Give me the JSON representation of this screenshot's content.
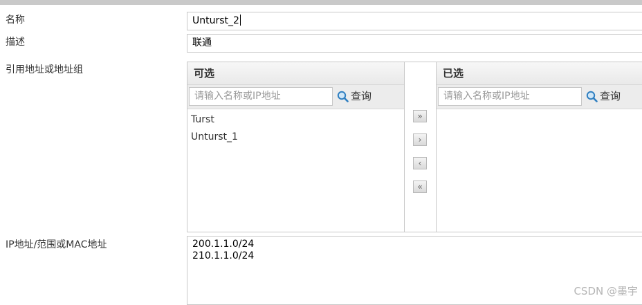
{
  "form": {
    "name_label": "名称",
    "name_value": "Unturst_2",
    "desc_label": "描述",
    "desc_value": "联通",
    "ref_label": "引用地址或地址组",
    "ip_label": "IP地址/范围或MAC地址",
    "ip_lines": [
      "200.1.1.0/24",
      "210.1.1.0/24"
    ]
  },
  "available": {
    "title": "可选",
    "search_placeholder": "请输入名称或IP地址",
    "search_button": "查询",
    "items": [
      "Turst",
      "Unturst_1"
    ]
  },
  "selected": {
    "title": "已选",
    "search_placeholder": "请输入名称或IP地址",
    "search_button": "查询",
    "items": []
  },
  "transfer_buttons": [
    "»",
    "›",
    "‹",
    "«"
  ],
  "watermark": "CSDN @墨宇",
  "icons": {
    "search": "magnifier-icon"
  }
}
